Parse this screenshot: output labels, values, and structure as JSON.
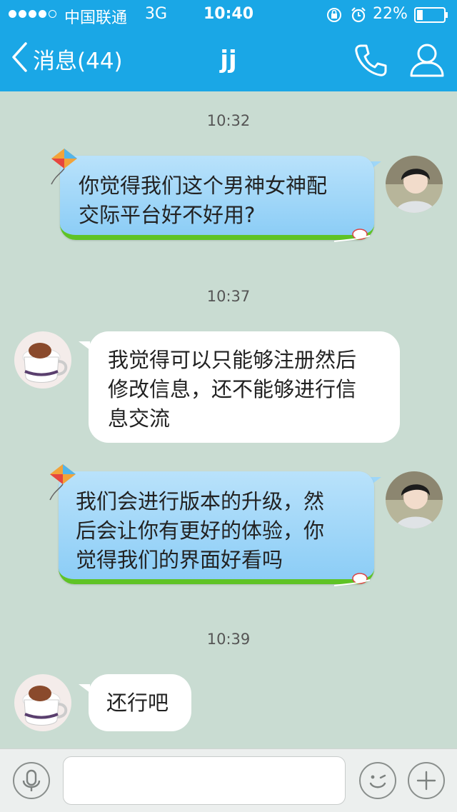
{
  "status_bar": {
    "carrier": "中国联通",
    "network": "3G",
    "time": "10:40",
    "battery": "22%",
    "battery_level": 0.22
  },
  "nav": {
    "back_label": "消息(44)",
    "title": "jj"
  },
  "colors": {
    "header": "#1aa7e6",
    "background": "#c9dcd2",
    "outgoing_bubble": "#9ed6f8",
    "grass": "#5fc326"
  },
  "messages": [
    {
      "timestamp": "10:32",
      "direction": "outgoing",
      "lines": [
        "你觉得我们这个男神女神配",
        "交际平台好不好用?"
      ]
    },
    {
      "timestamp": "10:37",
      "direction": "incoming",
      "lines": [
        "我觉得可以只能够注册然后",
        "修改信息，还不能够进行信",
        "息交流"
      ]
    },
    {
      "timestamp": "",
      "direction": "outgoing",
      "lines": [
        "我们会进行版本的升级，然",
        "后会让你有更好的体验，你",
        "觉得我们的界面好看吗"
      ]
    },
    {
      "timestamp": "10:39",
      "direction": "incoming",
      "lines": [
        "还行吧"
      ]
    }
  ],
  "input_bar": {
    "placeholder": "",
    "icons": [
      "microphone-icon",
      "emoji-icon",
      "plus-icon"
    ]
  }
}
